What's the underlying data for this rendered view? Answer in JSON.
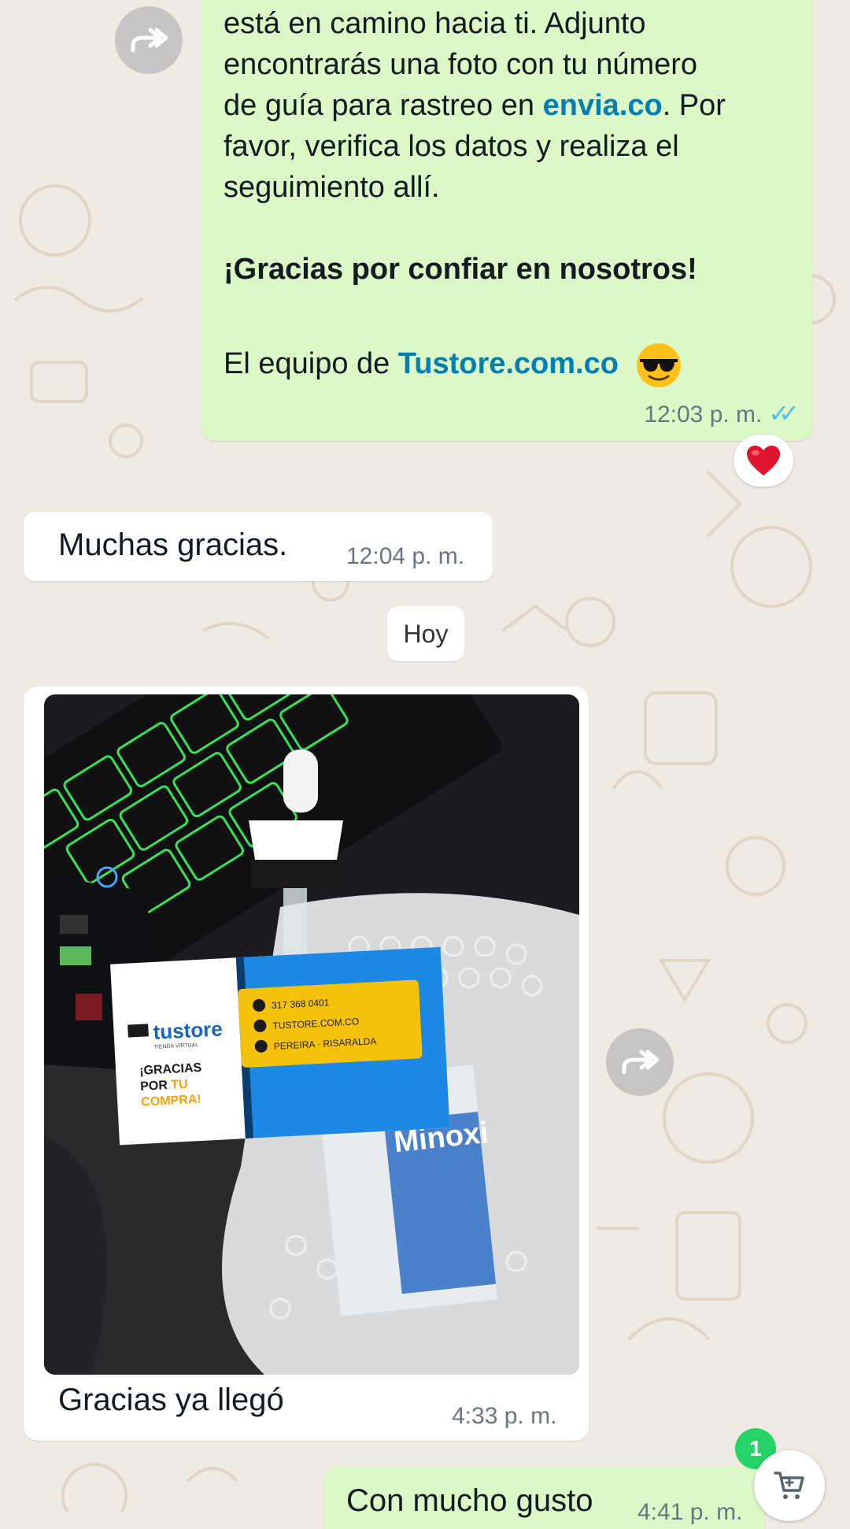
{
  "messages": [
    {
      "direction": "outgoing",
      "lines": {
        "l1": "está en camino hacia ti. Adjunto",
        "l2": "encontrarás una foto con tu número",
        "l3a": "de guía para rastreo en ",
        "l3link": "envia.co",
        "l3b": ". Por",
        "l4": "favor, verifica los datos y realiza el",
        "l5": "seguimiento allí.",
        "thanks": "¡Gracias por confiar en nosotros!",
        "sign": "El equipo de ",
        "signlink": "Tustore.com.co"
      },
      "time": "12:03 p. m.",
      "ticks": "✓✓",
      "reaction": "heart"
    },
    {
      "direction": "incoming",
      "text": "Muchas gracias.",
      "time": "12:04 p. m."
    },
    {
      "direction": "incoming",
      "image_card": {
        "brand": "tustore",
        "tagline": "TIENDA VIRTUAL",
        "thanks_line1": "¡GRACIAS",
        "thanks_line2a": "POR ",
        "thanks_line2b": "TU",
        "thanks_line3": "COMPRA!",
        "phone": "317 368 0401",
        "website": "TUSTORE.COM.CO",
        "location": "PEREIRA · RISARALDA"
      },
      "product_label": "Minoxi",
      "caption": "Gracias ya llegó",
      "time": "4:33 p. m."
    },
    {
      "direction": "outgoing",
      "text": "Con mucho gusto",
      "time": "4:41 p. m."
    }
  ],
  "date_separator": "Hoy",
  "unread_count": "1",
  "icons": {
    "forward": "forward-icon",
    "cart": "cart-icon",
    "reaction": "heart-icon",
    "emoji": "sunglasses-emoji"
  },
  "colors": {
    "outgoing_bubble": "#dcf8c6",
    "incoming_bubble": "#ffffff",
    "link": "#027eb5",
    "read_ticks": "#53bdeb",
    "badge": "#25d366",
    "chat_background": "#efeae2"
  }
}
